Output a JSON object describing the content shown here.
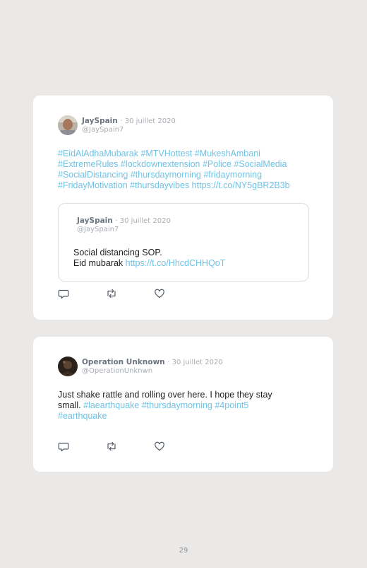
{
  "tweet1": {
    "name": "JaySpain",
    "date": "· 30 juillet 2020",
    "handle": "@JaySpain7",
    "hashtag_lines": [
      "#EidAlAdhaMubarak #MTVHottest #MukeshAmbani",
      "#ExtremeRules #lockdownextension #Police #SocialMedia",
      "#SocialDistancing #thursdaymorning #fridaymorning",
      "#FridayMotivation #thursdayvibes https://t.co/NY5gBR2B3b"
    ],
    "quote": {
      "name": "JaySpain",
      "date": "· 30 juillet 2020",
      "handle": "@JaySpain7",
      "line1": "Social distancing SOP.",
      "line2_text": "Eid mubarak ",
      "line2_link": "https://t.co/HhcdCHHQoT"
    }
  },
  "tweet2": {
    "name": "Operation Unknown",
    "date": "· 30 juillet 2020",
    "handle": "@OperationUnknwn",
    "line1": "Just shake rattle and rolling over here. I hope they stay",
    "line2_text": "small. ",
    "line2_tags": "#laearthquake #thursdaymorning #4point5",
    "line3_tags": "#earthquake"
  },
  "icons": [
    "reply-icon",
    "retweet-icon",
    "like-icon"
  ],
  "colors": {
    "link": "#6fc3e6",
    "background": "#eae9e7",
    "card": "#ffffff"
  },
  "page_number": "29"
}
